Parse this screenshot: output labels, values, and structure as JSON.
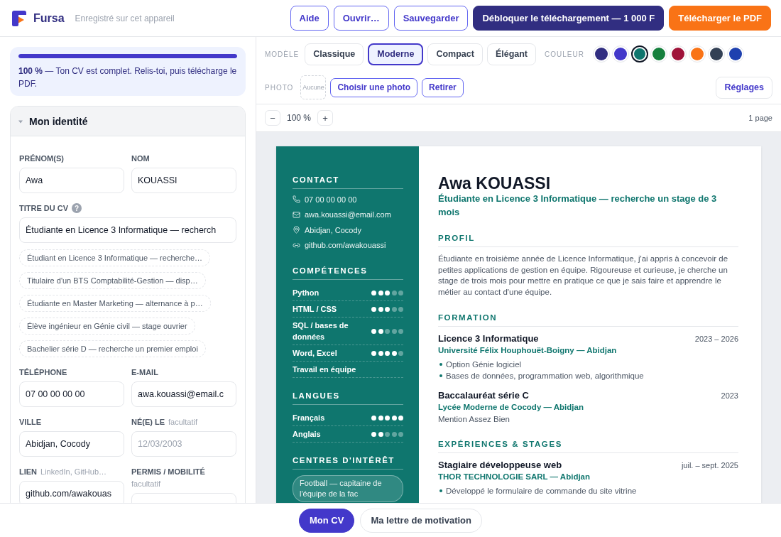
{
  "header": {
    "brand": "Fursa",
    "save_status": "Enregistré sur cet appareil",
    "actions": [
      {
        "label": "Aide",
        "kind": "outline"
      },
      {
        "label": "Ouvrir…",
        "kind": "outline"
      },
      {
        "label": "Sauvegarder",
        "kind": "outline"
      },
      {
        "label": "Débloquer le téléchargement — 1 000 F",
        "kind": "dark"
      },
      {
        "label": "Télécharger le PDF",
        "kind": "accent"
      }
    ]
  },
  "progress": {
    "level": 1,
    "message": "**100 %** — Ton CV est complet. Relis-toi, puis télécharge le PDF."
  },
  "identity": {
    "title": "Mon identité",
    "expanded": true,
    "name_fields": [
      {
        "label": "PRÉNOM(S)",
        "value": "Awa"
      },
      {
        "label": "NOM",
        "value": "KOUASSI"
      }
    ],
    "cv_title": {
      "label": "TITRE DU CV",
      "help": "?",
      "value": "Étudiante en Licence 3 Informatique — recherch",
      "suggestions": [
        "Étudiant en Licence 3 Informatique — recherche…",
        "Titulaire d'un BTS Comptabilité-Gestion — disp…",
        "Étudiante en Master Marketing — alternance à p…",
        "Élève ingénieur en Génie civil — stage ouvrier",
        "Bachelier série D — recherche un premier emploi"
      ]
    },
    "detail_fields": [
      {
        "label": "TÉLÉPHONE",
        "value": "07 00 00 00 00"
      },
      {
        "label": "E-MAIL",
        "value": "awa.kouassi@email.c"
      },
      {
        "label": "VILLE",
        "value": "Abidjan, Cocody"
      },
      {
        "label": "NÉ(E) LE",
        "hint": "facultatif",
        "placeholder": "12/03/2003"
      },
      {
        "label": "LIEN",
        "hint": "LinkedIn, GitHub…",
        "value": "github.com/awakouas"
      },
      {
        "label": "PERMIS / MOBILITÉ",
        "hint": "facultatif"
      }
    ]
  },
  "preview": {
    "template_label": "MODÈLE",
    "templates": [
      {
        "label": "Classique",
        "selected": false
      },
      {
        "label": "Moderne",
        "selected": true
      },
      {
        "label": "Compact",
        "selected": false
      },
      {
        "label": "Élégant",
        "selected": false
      }
    ],
    "color_label": "COULEUR",
    "colors": [
      {
        "color": "#312e81",
        "selected": false
      },
      {
        "color": "#4338ca",
        "selected": false
      },
      {
        "color": "#0f766e",
        "selected": true
      },
      {
        "color": "#15803d",
        "selected": false
      },
      {
        "color": "#9f1239",
        "selected": false
      },
      {
        "color": "#f97316",
        "selected": false
      },
      {
        "color": "#334155",
        "selected": false
      },
      {
        "color": "#1e40af",
        "selected": false
      }
    ],
    "photo_label": "PHOTO",
    "photo_placeholder": "Aucune",
    "photo_actions": [
      "Choisir une photo",
      "Retirer"
    ],
    "settings": "Réglages",
    "zoom_out": "−",
    "zoom": "100 %",
    "zoom_in": "+",
    "page_count": "1 page"
  },
  "cv": {
    "sidebar": {
      "contact": {
        "title": "CONTACT",
        "phone": "07 00 00 00 00",
        "email": "awa.kouassi@email.com",
        "city": "Abidjan, Cocody",
        "link": "github.com/awakouassi"
      },
      "skills": {
        "title": "COMPÉTENCES",
        "items": [
          {
            "name": "Python",
            "stars": 3
          },
          {
            "name": "HTML / CSS",
            "stars": 3
          },
          {
            "name": "SQL / bases de données",
            "stars": 2
          },
          {
            "name": "Word, Excel",
            "stars": 4
          },
          {
            "name": "Travail en équipe"
          }
        ]
      },
      "languages": {
        "title": "LANGUES",
        "items": [
          {
            "name": "Français",
            "stars": 5
          },
          {
            "name": "Anglais",
            "stars": 2
          }
        ]
      },
      "interests": {
        "title": "CENTRES D'INTÉRÊT",
        "items": [
          "Football — capitaine de l'équipe de la fac"
        ]
      }
    },
    "name": "Awa KOUASSI",
    "headline": "Étudiante en Licence 3 Informatique — recherche un stage de 3 mois",
    "profile": {
      "title": "PROFIL",
      "text": "Étudiante en troisième année de Licence Informatique, j'ai appris à concevoir de petites applications de gestion en équipe. Rigoureuse et curieuse, je cherche un stage de trois mois pour mettre en pratique ce que je sais faire et apprendre le métier au contact d'une équipe."
    },
    "education": {
      "title": "FORMATION",
      "entries": [
        {
          "title": "Licence 3 Informatique",
          "dates": "2023 – 2026",
          "org": "Université Félix Houphouët-Boigny — Abidjan",
          "bullets": [
            "Option Génie logiciel",
            "Bases de données, programmation web, algorithmique"
          ]
        },
        {
          "title": "Baccalauréat série C",
          "dates": "2023",
          "org": "Lycée Moderne de Cocody — Abidjan",
          "note": "Mention Assez Bien"
        }
      ]
    },
    "experience": {
      "title": "EXPÉRIENCES & STAGES",
      "entries": [
        {
          "title": "Stagiaire développeuse web",
          "dates": "juil. – sept. 2025",
          "org": "THOR TECHNOLOGIE SARL — Abidjan",
          "bullets": [
            "Développé le formulaire de commande du site vitrine"
          ]
        }
      ]
    }
  },
  "tabs": [
    {
      "label": "Mon CV",
      "selected": true
    },
    {
      "label": "Ma lettre de motivation",
      "selected": false
    }
  ]
}
